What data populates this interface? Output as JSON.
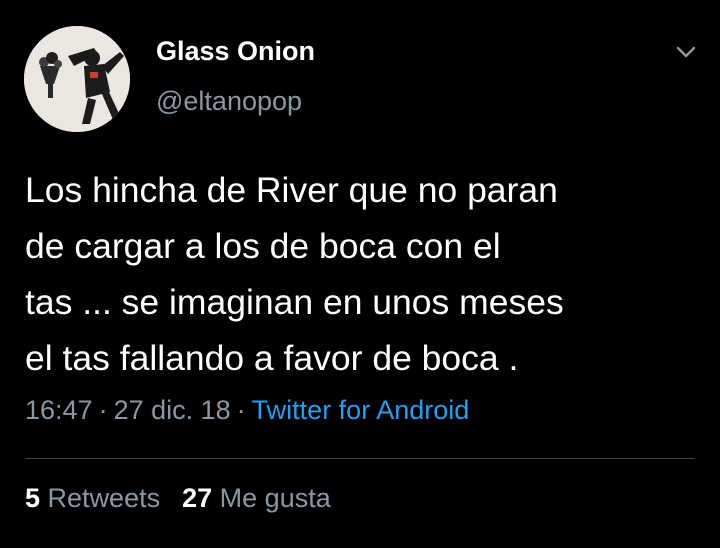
{
  "author": {
    "display_name": "Glass Onion",
    "handle": "@eltanopop",
    "avatar_icon": "banksy-flower-thrower-avatar"
  },
  "menu_icon": "chevron-down-icon",
  "tweet": {
    "lines": [
      "Los hincha de River que no paran",
      "de cargar a los de boca con el",
      "tas ... se imaginan en unos meses",
      "el tas fallando a favor de boca ."
    ]
  },
  "meta": {
    "time": "16:47",
    "separator": "·",
    "date": "27 dic. 18",
    "source": "Twitter for Android"
  },
  "stats": {
    "retweets_count": "5",
    "retweets_label": "Retweets",
    "likes_count": "27",
    "likes_label": "Me gusta"
  },
  "colors": {
    "background": "#000000",
    "text": "#ffffff",
    "secondary": "#8899a6",
    "link": "#1da1f2",
    "divider": "#38444d"
  }
}
